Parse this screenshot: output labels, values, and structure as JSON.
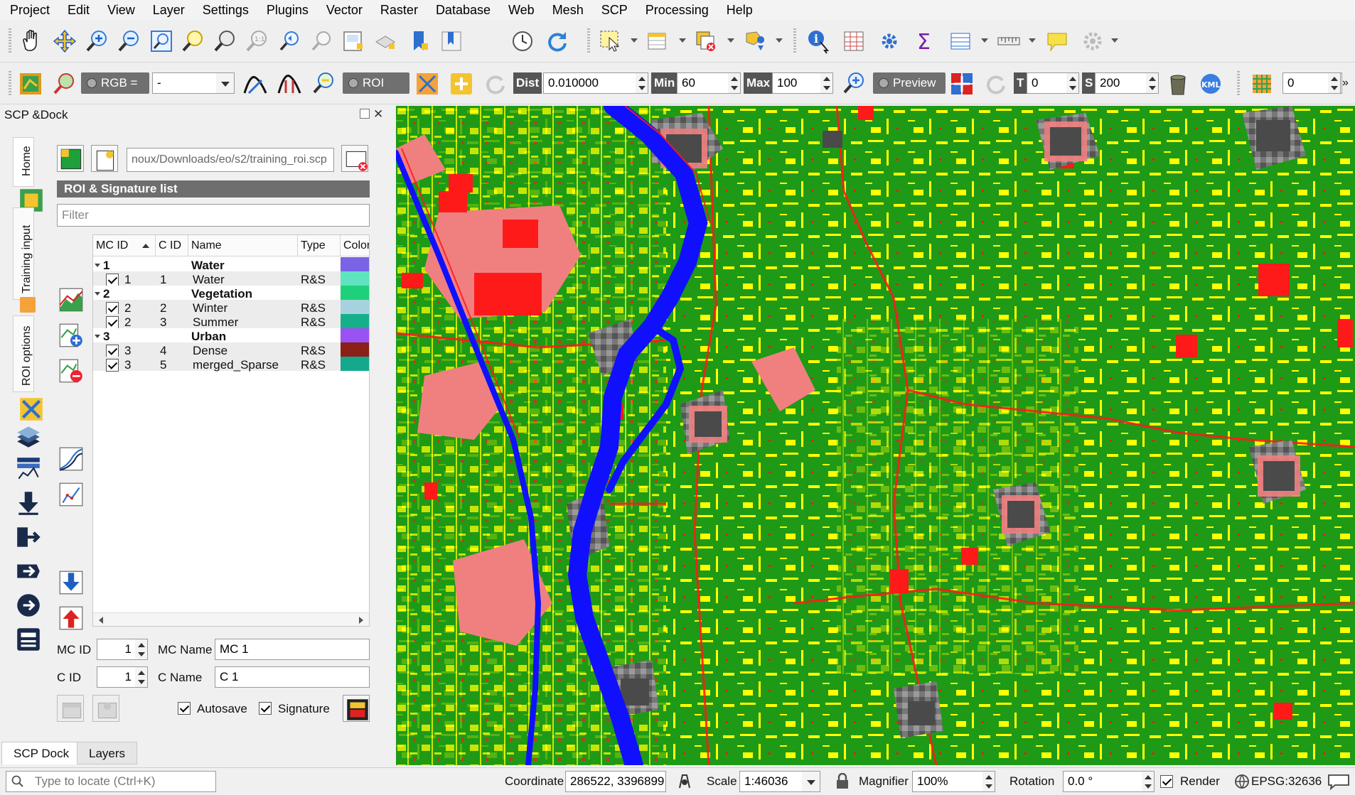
{
  "menu": [
    "Project",
    "Edit",
    "View",
    "Layer",
    "Settings",
    "Plugins",
    "Vector",
    "Raster",
    "Database",
    "Web",
    "Mesh",
    "SCP",
    "Processing",
    "Help"
  ],
  "toolbar2": {
    "rgb_label": "RGB =",
    "rgb_value": "-",
    "roi_label": "ROI",
    "dist_label": "Dist",
    "dist_value": "0.010000",
    "min_label": "Min",
    "min_value": "60",
    "max_label": "Max",
    "max_value": "100",
    "preview_label": "Preview",
    "t_label": "T",
    "t_value": "0",
    "s_label": "S",
    "s_value": "200",
    "kml_label": "KML",
    "last_value": "0"
  },
  "dock": {
    "title": "SCP &Dock",
    "vtabs": [
      "Home",
      "Training input",
      "ROI options"
    ],
    "training_path": "noux/Downloads/eo/s2/training_roi.scp",
    "roi_header": "ROI & Signature list",
    "filter_placeholder": "Filter",
    "columns": [
      "MC ID",
      "C ID",
      "Name",
      "Type",
      "Color"
    ],
    "tree": [
      {
        "kind": "group",
        "mc_id": "1",
        "name": "Water",
        "color": "#7b63e6"
      },
      {
        "kind": "item",
        "mc_id": "1",
        "c_id": "1",
        "name": "Water",
        "type": "R&S",
        "color": "#5fe3c0"
      },
      {
        "kind": "group",
        "mc_id": "2",
        "name": "Vegetation",
        "color": "#1fd07a"
      },
      {
        "kind": "item",
        "mc_id": "2",
        "c_id": "2",
        "name": "Winter",
        "type": "R&S",
        "color": "#a6d2de"
      },
      {
        "kind": "item",
        "mc_id": "2",
        "c_id": "3",
        "name": "Summer",
        "type": "R&S",
        "color": "#15b08a"
      },
      {
        "kind": "group",
        "mc_id": "3",
        "name": "Urban",
        "color": "#9b52f2"
      },
      {
        "kind": "item",
        "mc_id": "3",
        "c_id": "4",
        "name": "Dense",
        "type": "R&S",
        "color": "#8a2018"
      },
      {
        "kind": "item",
        "mc_id": "3",
        "c_id": "5",
        "name": "merged_Sparse",
        "type": "R&S",
        "color": "#14a98c"
      }
    ],
    "mc_id_label": "MC ID",
    "mc_id_value": "1",
    "mc_name_label": "MC Name",
    "mc_name_value": "MC 1",
    "c_id_label": "C ID",
    "c_id_value": "1",
    "c_name_label": "C Name",
    "c_name_value": "C 1",
    "autosave_label": "Autosave",
    "signature_label": "Signature"
  },
  "bottom_tabs": [
    "SCP Dock",
    "Layers"
  ],
  "status": {
    "locate_placeholder": "Type to locate (Ctrl+K)",
    "coordinate_label": "Coordinate",
    "coordinate_value": "286522, 3396899",
    "scale_label": "Scale",
    "scale_value": "1:46036",
    "magnifier_label": "Magnifier",
    "magnifier_value": "100%",
    "rotation_label": "Rotation",
    "rotation_value": "0.0 °",
    "render_label": "Render",
    "crs_label": "EPSG:32636"
  },
  "map_colors": {
    "vegetation": "#1e9a16",
    "bare": "#ffff00",
    "urban": "#ff1a1a",
    "sparse": "#f08080",
    "water": "#1010ff",
    "dense_urban": "#555555"
  },
  "icons_tb1": [
    "pan-icon",
    "pan-to-selection-icon",
    "zoom-in-icon",
    "zoom-out-icon",
    "zoom-full-icon",
    "zoom-to-selection-icon",
    "zoom-to-layer-icon",
    "zoom-native-icon",
    "zoom-last-icon",
    "zoom-next-icon",
    "new-map-view-icon",
    "new-3d-map-icon",
    "bookmark-new-icon",
    "bookmarks-icon",
    "temporal-icon",
    "refresh-icon",
    "select-feature-icon",
    "attribute-table-icon",
    "deselect-icon",
    "select-location-icon",
    "identify-icon",
    "field-calculator-icon",
    "processing-toolbox-icon",
    "statistics-icon",
    "open-table-icon",
    "measure-icon",
    "map-tips-icon",
    "settings-gear-icon"
  ]
}
